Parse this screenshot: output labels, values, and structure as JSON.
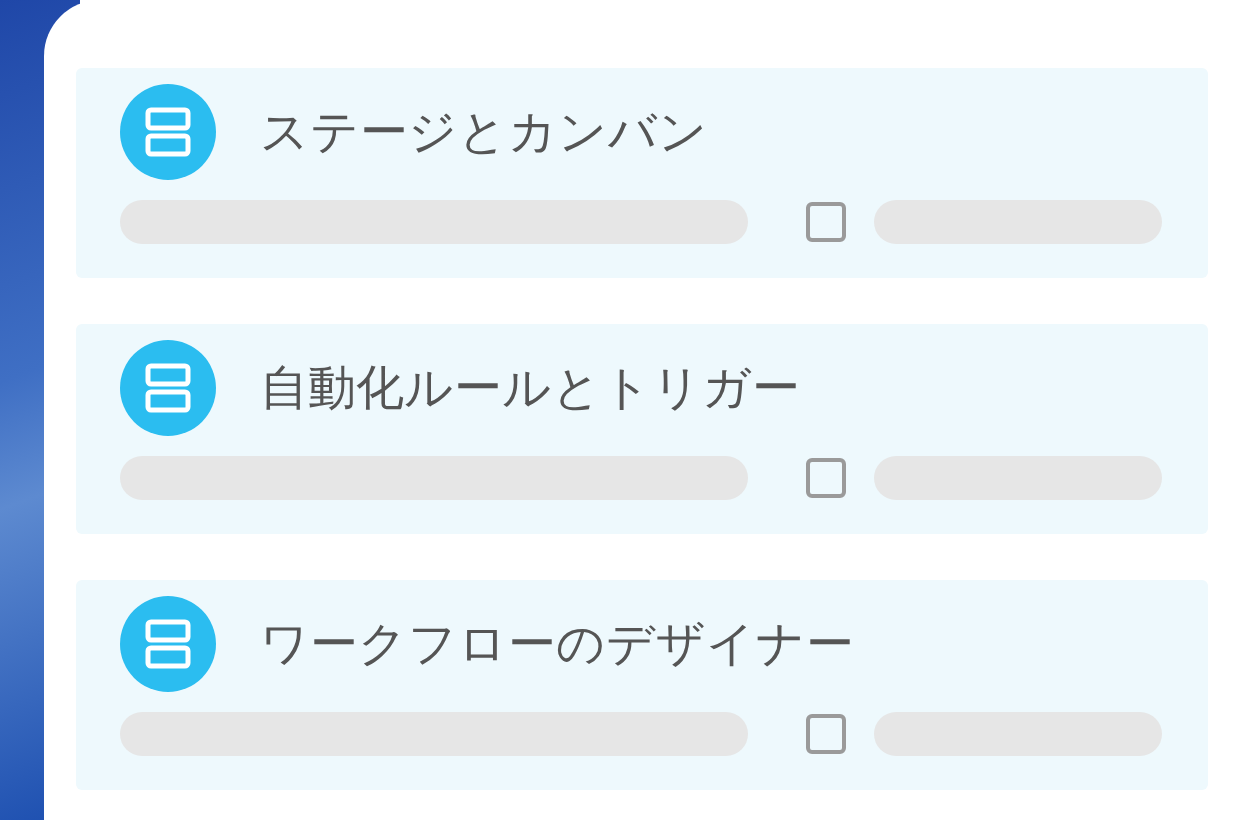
{
  "cards": [
    {
      "title": "ステージとカンバン",
      "checked": false
    },
    {
      "title": "自動化ルールとトリガー",
      "checked": false
    },
    {
      "title": "ワークフローのデザイナー",
      "checked": false
    }
  ]
}
